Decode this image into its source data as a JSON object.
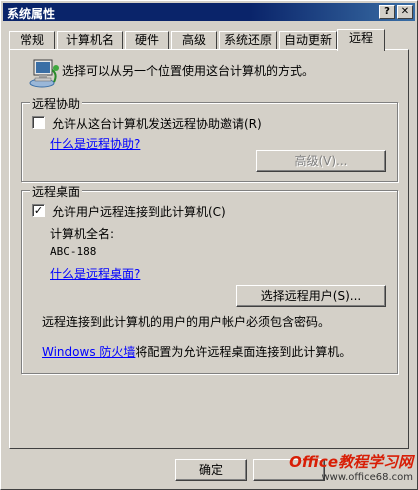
{
  "window": {
    "title": "系统属性",
    "help_button": "?",
    "close_button": "✕"
  },
  "tabs": [
    {
      "label": "常规"
    },
    {
      "label": "计算机名"
    },
    {
      "label": "硬件"
    },
    {
      "label": "高级"
    },
    {
      "label": "系统还原"
    },
    {
      "label": "自动更新"
    },
    {
      "label": "远程"
    }
  ],
  "active_tab": "远程",
  "intro": {
    "icon": "computer-network-icon",
    "text": "选择可以从另一个位置使用这台计算机的方式。"
  },
  "remote_assistance": {
    "legend": "远程协助",
    "checkbox_label": "允许从这台计算机发送远程协助邀请(R)",
    "checked": false,
    "help_link": "什么是远程协助?",
    "advanced_button": "高级(V)...",
    "advanced_enabled": false
  },
  "remote_desktop": {
    "legend": "远程桌面",
    "checkbox_label": "允许用户远程连接到此计算机(C)",
    "checked": true,
    "full_name_label": "计算机全名:",
    "full_name_value": "ABC-188",
    "help_link": "什么是远程桌面?",
    "select_users_button": "选择远程用户(S)...",
    "password_note": "远程连接到此计算机的用户的用户帐户必须包含密码。",
    "firewall_link": "Windows 防火墙",
    "firewall_text": "将配置为允许远程桌面连接到此计算机。"
  },
  "footer": {
    "ok_button": "确定"
  },
  "watermark": {
    "brand": "Office教程学习网",
    "url": "www.office68.com"
  }
}
